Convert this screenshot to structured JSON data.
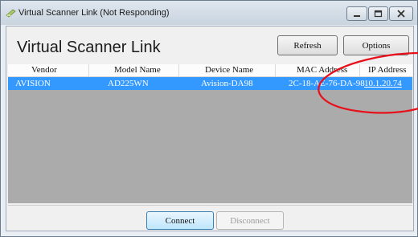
{
  "window": {
    "title": "Virtual Scanner Link (Not Responding)"
  },
  "header": {
    "title": "Virtual Scanner Link",
    "refresh_label": "Refresh",
    "options_label": "Options"
  },
  "table": {
    "columns": [
      "Vendor",
      "Model Name",
      "Device Name",
      "MAC Address",
      "IP Address"
    ],
    "rows": [
      {
        "vendor": "AVISION",
        "model": "AD225WN",
        "device": "Avision-DA98",
        "mac": "2C-18-AE-76-DA-98",
        "ip": "10.1.20.74"
      }
    ]
  },
  "footer": {
    "connect_label": "Connect",
    "disconnect_label": "Disconnect"
  },
  "colors": {
    "selection": "#3399ff",
    "annotation": "#e8101a",
    "empty_list": "#ababab"
  },
  "icons": [
    "scanner-app-icon",
    "minimize-icon",
    "maximize-icon",
    "close-icon"
  ]
}
